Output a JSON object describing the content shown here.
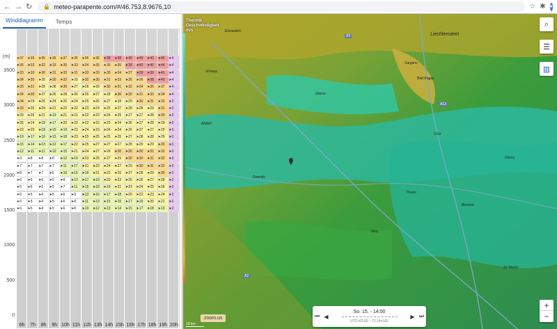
{
  "browser": {
    "url": "meteo-parapente.com/#/46.753,8.9676,10",
    "back": "←",
    "forward": "→",
    "reload": "↻"
  },
  "left_panel": {
    "tabs": [
      {
        "label": "Winddiagramm",
        "active": true
      },
      {
        "label": "Temps",
        "active": false
      }
    ],
    "y_unit": "(m)",
    "y_ticks": [
      {
        "label": "3500",
        "value": 3500
      },
      {
        "label": "3000",
        "value": 3000
      },
      {
        "label": "2500",
        "value": 2500
      },
      {
        "label": "2000",
        "value": 2000
      },
      {
        "label": "1500",
        "value": 1500
      },
      {
        "label": "1000",
        "value": 1000
      },
      {
        "label": "500",
        "value": 500
      },
      {
        "label": "0",
        "value": 0
      }
    ],
    "hours": [
      "6h",
      "7h",
      "8h",
      "9h",
      "10h",
      "11h",
      "12h",
      "13h",
      "14h",
      "15h",
      "16h",
      "17h",
      "18h",
      "19h",
      "20h"
    ],
    "rows": [
      [
        "37",
        "35",
        "35",
        "35",
        "37",
        "35",
        "36",
        "36",
        "38",
        "38",
        "40",
        "40",
        "43",
        "46",
        "4"
      ],
      [
        "35",
        "33",
        "32",
        "33",
        "35",
        "33",
        "34",
        "35",
        "35",
        "36",
        "39",
        "40",
        "40",
        "44",
        "4"
      ],
      [
        "33",
        "30",
        "30",
        "31",
        "33",
        "31",
        "33",
        "33",
        "33",
        "34",
        "37",
        "39",
        "39",
        "41",
        "4"
      ],
      [
        "34",
        "30",
        "28",
        "30",
        "32",
        "29",
        "30",
        "30",
        "31",
        "33",
        "35",
        "36",
        "38",
        "40",
        "4"
      ],
      [
        "33",
        "31",
        "28",
        "28",
        "30",
        "27",
        "28",
        "29",
        "30",
        "31",
        "32",
        "34",
        "36",
        "37",
        "4"
      ],
      [
        "34",
        "30",
        "27",
        "26",
        "28",
        "26",
        "26",
        "27",
        "28",
        "30",
        "30",
        "31",
        "33",
        "34",
        "4"
      ],
      [
        "34",
        "29",
        "26",
        "24",
        "26",
        "24",
        "25",
        "26",
        "27",
        "28",
        "29",
        "30",
        "31",
        "33",
        "3"
      ],
      [
        "33",
        "26",
        "24",
        "21",
        "22",
        "22",
        "23",
        "24",
        "25",
        "27",
        "28",
        "28",
        "29",
        "31",
        "3"
      ],
      [
        "29",
        "26",
        "21",
        "19",
        "21",
        "21",
        "22",
        "23",
        "24",
        "25",
        "27",
        "27",
        "28",
        "30",
        "3"
      ],
      [
        "26",
        "24",
        "19",
        "17",
        "20",
        "22",
        "22",
        "22",
        "23",
        "24",
        "26",
        "27",
        "28",
        "29",
        "3"
      ],
      [
        "23",
        "20",
        "18",
        "15",
        "19",
        "23",
        "24",
        "23",
        "24",
        "24",
        "26",
        "27",
        "27",
        "29",
        "3"
      ],
      [
        "19",
        "17",
        "16",
        "15",
        "18",
        "23",
        "25",
        "25",
        "25",
        "25",
        "27",
        "28",
        "28",
        "29",
        "3"
      ],
      [
        "15",
        "14",
        "13",
        "12",
        "17",
        "22",
        "25",
        "27",
        "27",
        "27",
        "28",
        "29",
        "29",
        "30",
        "3"
      ],
      [
        "12",
        "11",
        "11",
        "10",
        "15",
        "21",
        "24",
        "27",
        "28",
        "30",
        "30",
        "30",
        "31",
        "32",
        "3"
      ],
      [
        "9",
        "8",
        "8",
        "8",
        "12",
        "19",
        "23",
        "25",
        "27",
        "29",
        "30",
        "30",
        "31",
        "32",
        "3"
      ],
      [
        "7",
        "7",
        "7",
        "7",
        "11",
        "17",
        "21",
        "23",
        "24",
        "27",
        "29",
        "30",
        "31",
        "32",
        "3"
      ],
      [
        "8",
        "7",
        "7",
        "6",
        "10",
        "15",
        "19",
        "21",
        "22",
        "25",
        "27",
        "28",
        "29",
        "30",
        "3"
      ],
      [
        "6",
        "6",
        "6",
        "5",
        "8",
        "13",
        "17",
        "19",
        "20",
        "23",
        "25",
        "26",
        "27",
        "28",
        "3"
      ],
      [
        "5",
        "6",
        "5",
        "5",
        "7",
        "11",
        "15",
        "18",
        "19",
        "21",
        "23",
        "24",
        "25",
        "26",
        "3"
      ],
      [
        "6",
        "5",
        "4",
        "5",
        "6",
        "9",
        "13",
        "16",
        "17",
        "18",
        "20",
        "22",
        "23",
        "24",
        "2"
      ],
      [
        "6",
        "5",
        "4",
        "5",
        "6",
        "8",
        "11",
        "13",
        "15",
        "16",
        "17",
        "19",
        "20",
        "21",
        "2"
      ],
      [
        "6",
        "5",
        "4",
        "5",
        "6",
        "8",
        "10",
        "12",
        "13",
        "14",
        "15",
        "17",
        "18",
        "19",
        "2"
      ]
    ]
  },
  "map": {
    "legend_title": [
      "Thermik",
      "Geschwindigkeit",
      "m/s"
    ],
    "places": [
      "Einsiedeln",
      "Liechtenstein",
      "Schwyz",
      "Glarus",
      "Sargans",
      "Bad Ragaz",
      "Chur",
      "Davos",
      "Altdorf",
      "Thusis",
      "Disentis",
      "Ilanz",
      "Bernina",
      "St. Moritz"
    ],
    "roads": [
      "A3",
      "A13",
      "A2"
    ],
    "controls": {
      "search": "search",
      "layers": "layers",
      "chart": "chart"
    },
    "zoom_in": "+",
    "zoom_out": "−",
    "zoom_badge": "zoom.us",
    "scale": "10 km",
    "time": {
      "label": "So. 15. - 14:00",
      "utc": "UTC+02:00 -- Cl.14=16Z"
    }
  },
  "colors": {
    "accent": "#1a5fb4",
    "low": "#3a9c3b",
    "high": "#5fe2c6"
  }
}
